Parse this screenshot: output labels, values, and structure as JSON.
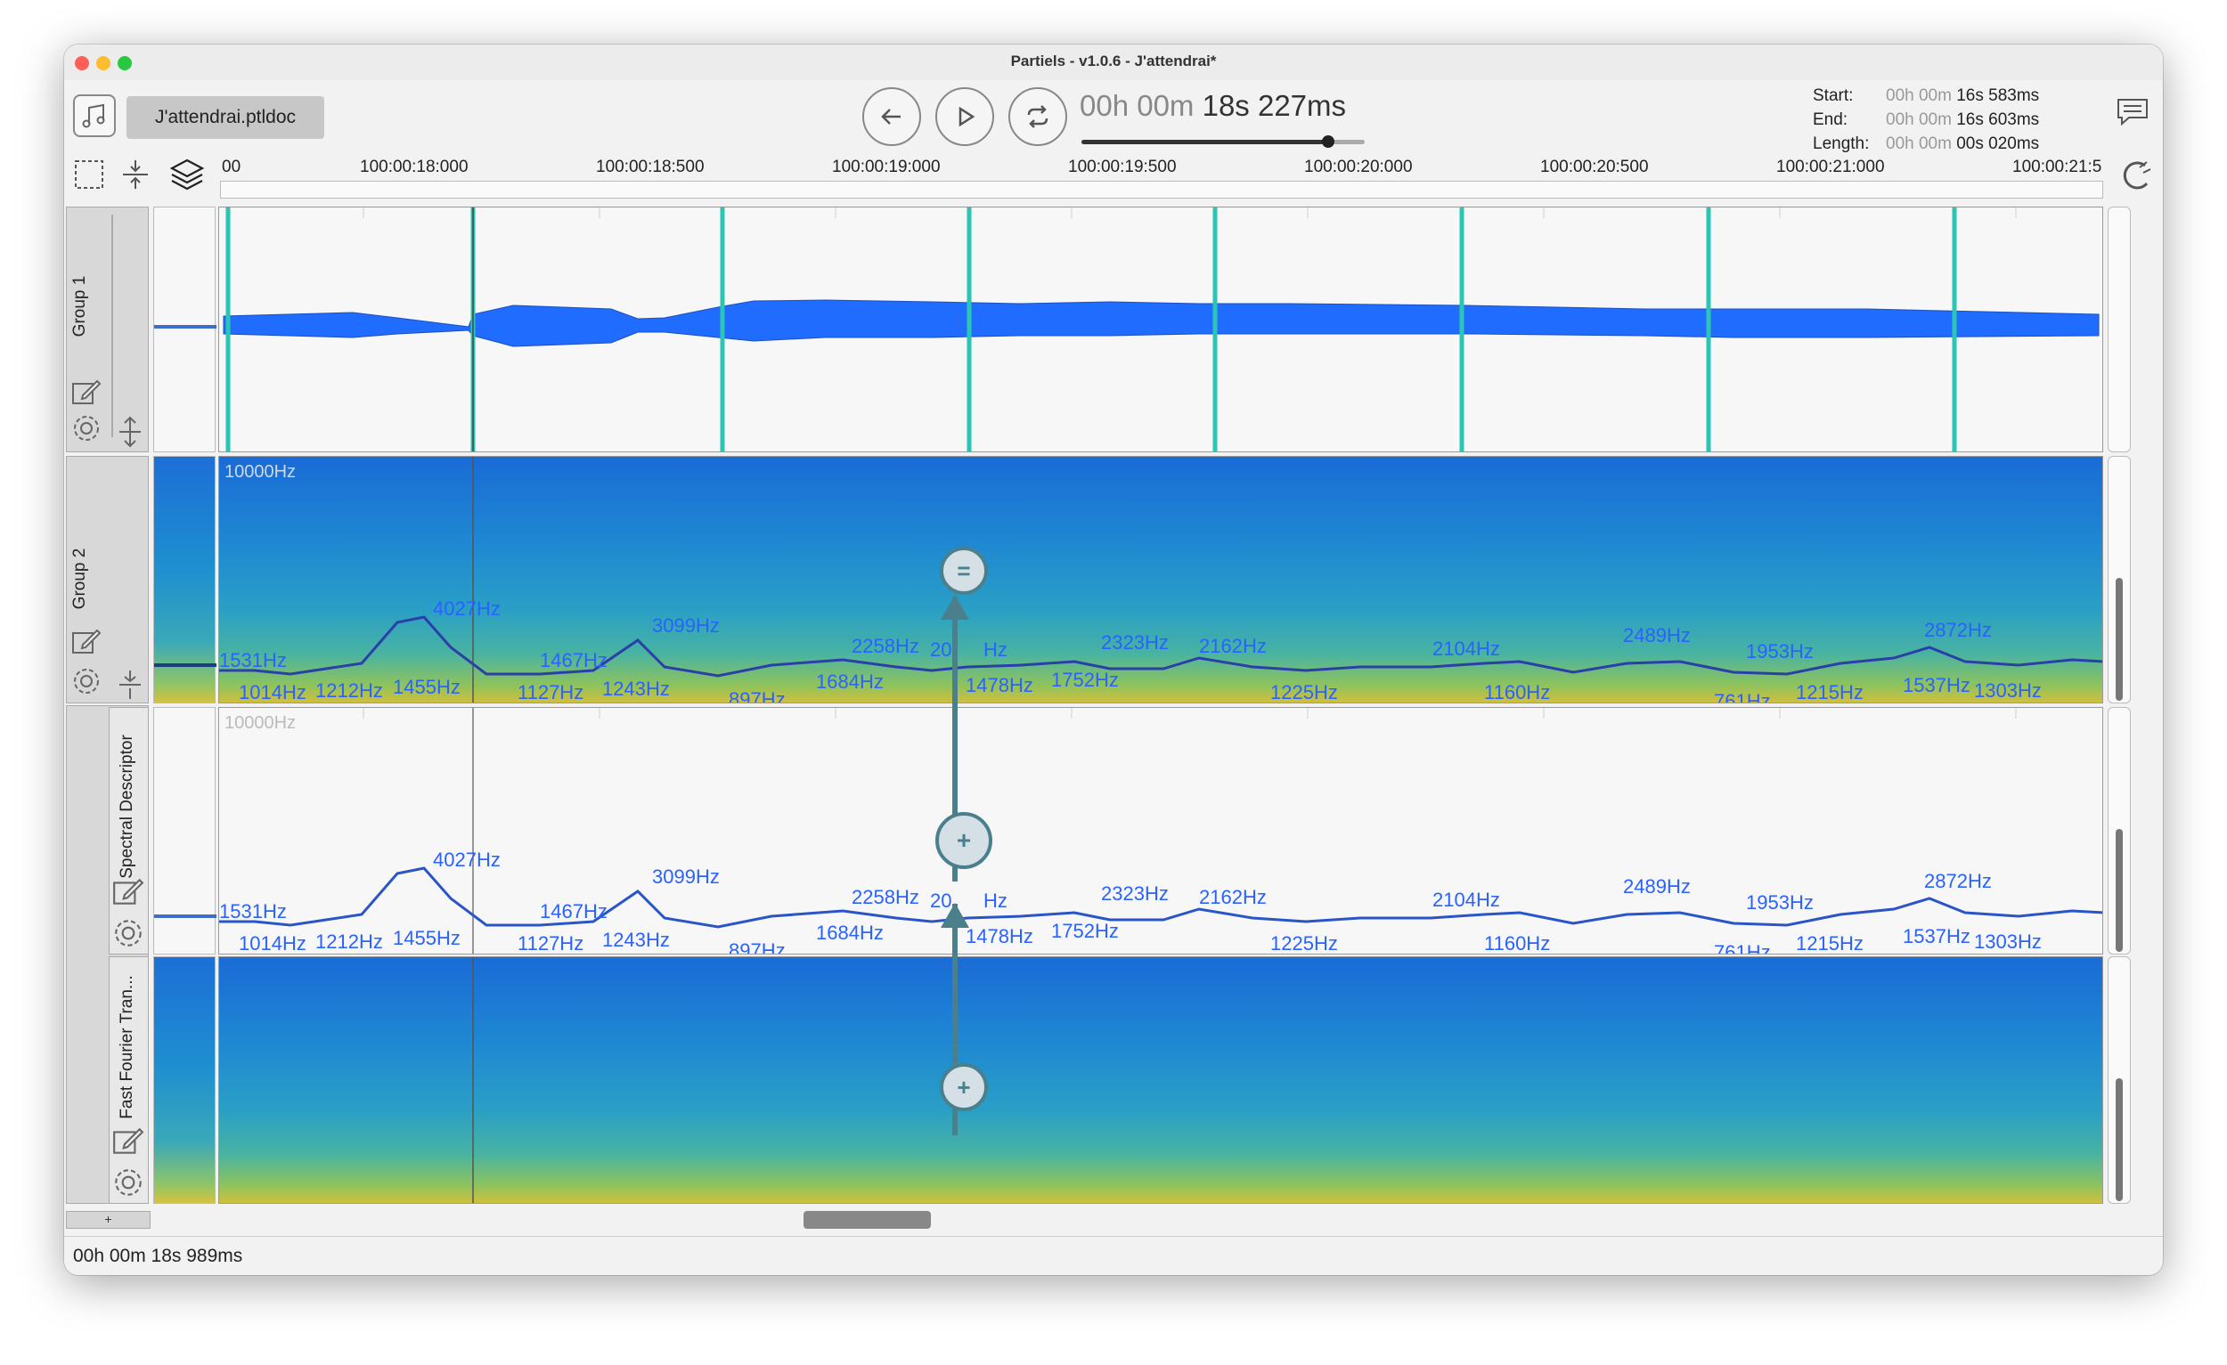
{
  "window": {
    "title": "Partiels - v1.0.6 - J'attendrai*"
  },
  "toolbar": {
    "document_button": "J'attendrai.ptldoc",
    "time_dim": "00h 00m ",
    "time_main": "18s 227ms",
    "playback_progress": 0.88,
    "selection": {
      "start_label": "Start:",
      "end_label": "End:",
      "length_label": "Length:",
      "start_dim": "00h 00m ",
      "start_hi": "16s 583ms",
      "end_dim": "00h 00m ",
      "end_hi": "16s 603ms",
      "length_dim": "00h 00m ",
      "length_hi": "00s 020ms"
    }
  },
  "ruler": {
    "labels": [
      "00",
      "100:00:18:000",
      "100:00:18:500",
      "100:00:19:000",
      "100:00:19:500",
      "100:00:20:000",
      "100:00:20:500",
      "100:00:21:000",
      "100:00:21:5"
    ]
  },
  "tracks": {
    "group1": {
      "label": "Group 1"
    },
    "group2": {
      "label": "Group 2",
      "hz_label": "10000Hz"
    },
    "spectral": {
      "label": "Spectral Descriptor",
      "hz_label": "10000Hz"
    },
    "fft": {
      "label": "Fast Fourier Tran..."
    }
  },
  "frequency_labels": {
    "upper": [
      "4027Hz",
      "3099Hz",
      "2258Hz",
      "2323Hz",
      "2162Hz",
      "2104Hz",
      "2489Hz",
      "1953Hz",
      "2872Hz",
      "1531Hz",
      "1467Hz",
      "20",
      "Hz"
    ],
    "lower": [
      "1014Hz",
      "1212Hz",
      "1455Hz",
      "1127Hz",
      "1243Hz",
      "897Hz",
      "1684Hz",
      "1478Hz",
      "1752Hz",
      "1225Hz",
      "1160Hz",
      "761Hz",
      "1215Hz",
      "1537Hz",
      "1303Hz"
    ]
  },
  "status": {
    "text": "00h 00m 18s 989ms"
  },
  "add_button": "+",
  "markers": {
    "top_symbol": "=",
    "mid_symbol": "+",
    "bottom_symbol": "+"
  },
  "colors": {
    "accent": "#2962ff",
    "marker": "#2bc6b3",
    "arrow": "#4a7f8c"
  }
}
